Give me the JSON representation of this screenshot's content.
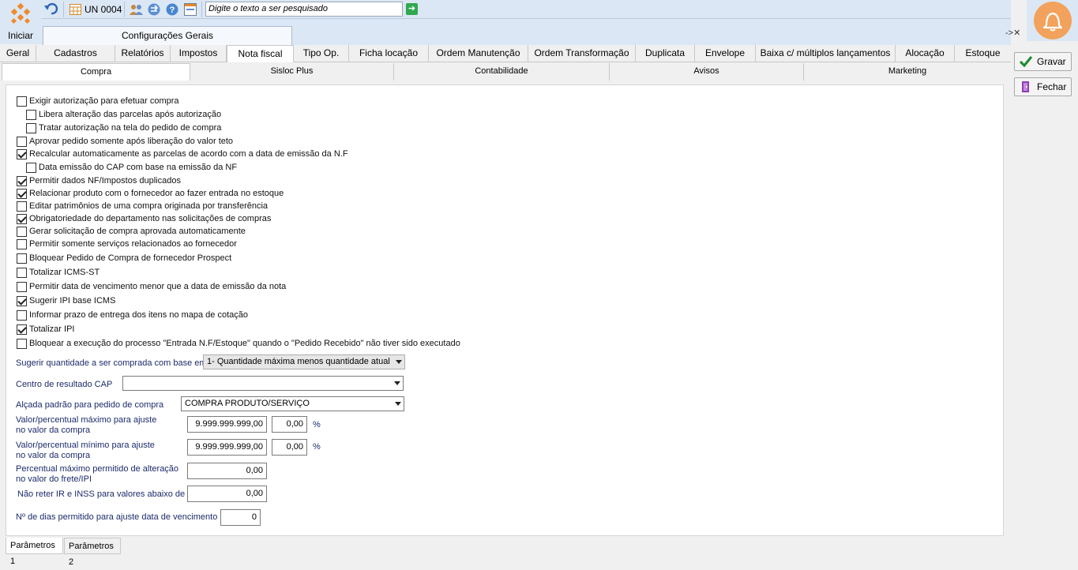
{
  "toolbar": {
    "start_label": "Iniciar",
    "unit_label": "UN 0004",
    "search_placeholder": "Digite o texto a ser pesquisado"
  },
  "window": {
    "title": "Configurações Gerais",
    "close_glyphs": "->✕"
  },
  "tabs_main": [
    "Geral",
    "Cadastros",
    "Relatórios",
    "Impostos",
    "Nota fiscal",
    "Tipo Op.",
    "Ficha locação",
    "Ordem Manutenção",
    "Ordem Transformação",
    "Duplicata",
    "Envelope",
    "Baixa c/ múltiplos lançamentos",
    "Alocação",
    "Estoque"
  ],
  "tabs_sub": [
    "Compra",
    "Sisloc Plus",
    "Contabilidade",
    "Avisos",
    "Marketing"
  ],
  "options": [
    {
      "label": "Exigir autorização para efetuar compra",
      "checked": false
    },
    {
      "label": "Libera alteração das parcelas após autorização",
      "checked": false
    },
    {
      "label": "Tratar autorização na tela do pedido de compra",
      "checked": false
    },
    {
      "label": "Aprovar pedido somente após liberação do valor teto",
      "checked": false
    },
    {
      "label": "Recalcular automaticamente as parcelas de acordo com a data de emissão da N.F",
      "checked": true
    },
    {
      "label": "Data emissão do CAP com base na emissão da NF",
      "checked": false
    },
    {
      "label": "Permitir dados NF/Impostos duplicados",
      "checked": true
    },
    {
      "label": "Relacionar produto com o fornecedor ao fazer entrada no estoque",
      "checked": true
    },
    {
      "label": "Editar patrimônios de uma compra originada por transferência",
      "checked": false
    },
    {
      "label": "Obrigatoriedade do departamento nas solicitações de compras",
      "checked": true
    },
    {
      "label": "Gerar solicitação de compra aprovada automaticamente",
      "checked": false
    },
    {
      "label": "Permitir somente serviços relacionados ao fornecedor",
      "checked": false
    },
    {
      "label": "Bloquear Pedido de Compra de fornecedor Prospect",
      "checked": false
    },
    {
      "label": "Totalizar ICMS-ST",
      "checked": false
    },
    {
      "label": "Permitir data de vencimento menor que a data de emissão da nota",
      "checked": false
    },
    {
      "label": "Sugerir IPI base ICMS",
      "checked": true
    },
    {
      "label": "Informar prazo de entrega dos itens no mapa de cotação",
      "checked": false
    },
    {
      "label": "Totalizar IPI",
      "checked": true
    },
    {
      "label": "Bloquear a execução do processo \"Entrada N.F/Estoque\" quando o \"Pedido Recebido\" não tiver sido executado",
      "checked": false
    }
  ],
  "fields": {
    "sugerir_label": "Sugerir quantidade a ser comprada com base em",
    "sugerir_value": "1- Quantidade máxima menos quantidade atual",
    "centro_label": "Centro de resultado CAP",
    "centro_value": "",
    "alcada_label": "Alçada padrão para pedido de compra",
    "alcada_value": "COMPRA PRODUTO/SERVIÇO",
    "vmax_label_1": "Valor/percentual máximo para ajuste",
    "vmax_label_2": "no valor da compra",
    "vmax_value": "9.999.999.999,00",
    "vmax_pct": "0,00",
    "vmin_label_1": "Valor/percentual mínimo para ajuste",
    "vmin_label_2": "no valor da compra",
    "vmin_value": "9.999.999.999,00",
    "vmin_pct": "0,00",
    "pct_symbol": "%",
    "frete_label_1": "Percentual máximo permitido de alteração",
    "frete_label_2": "no valor do frete/IPI",
    "frete_value": "0,00",
    "ir_label": "Não reter IR e INSS para valores abaixo de",
    "ir_value": "0,00",
    "dias_label": "Nº de dias permitido para ajuste data de vencimento",
    "dias_value": "0"
  },
  "actions": {
    "save": "Gravar",
    "close": "Fechar"
  },
  "bottom_tabs": [
    "Parâmetros 1",
    "Parâmetros 2"
  ]
}
